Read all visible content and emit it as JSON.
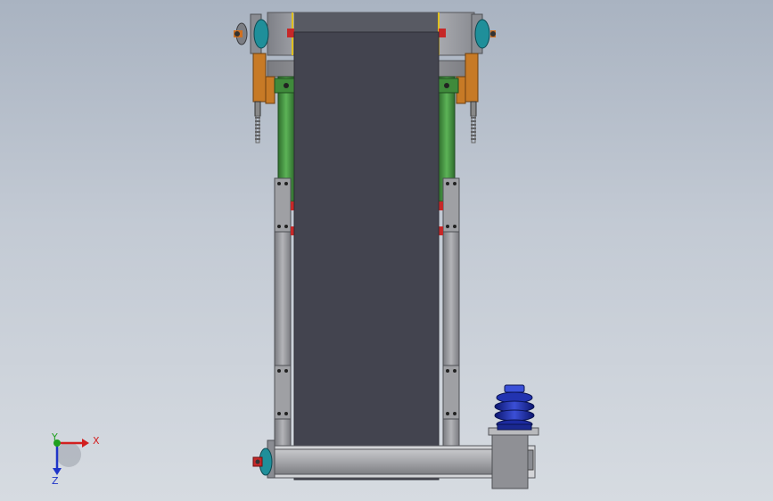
{
  "viewport": {
    "background_top": "#a9b3c1",
    "background_bottom": "#d6dbe1",
    "belt_color": "#43444f",
    "frame_color": "#9a9b9f",
    "green_column_color": "#4e9a4a",
    "bracket_color": "#c77a26",
    "motor_color": "#1f2fa8"
  },
  "triad": {
    "x_label": "X",
    "y_label": "Y",
    "z_label": "Z",
    "x_color": "#d21f1f",
    "y_color": "#1fa01f",
    "z_color": "#1f35c8"
  }
}
